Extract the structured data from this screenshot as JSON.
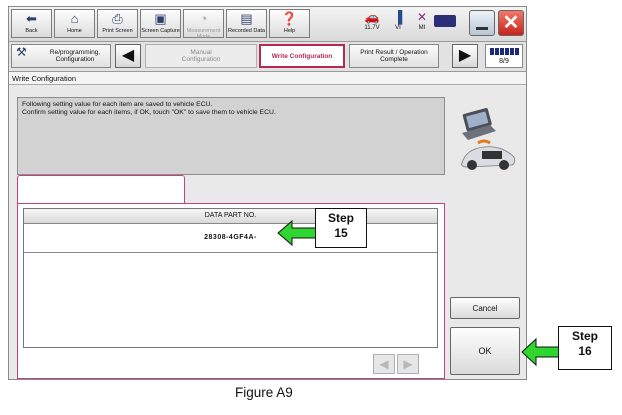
{
  "toolbar": {
    "buttons": [
      {
        "label": "Back",
        "icon": "back-arrow-icon"
      },
      {
        "label": "Home",
        "icon": "home-icon"
      },
      {
        "label": "Print Screen",
        "icon": "printer-icon"
      },
      {
        "label": "Screen Capture",
        "icon": "camera-icon"
      },
      {
        "label": "Measurement Mode",
        "icon": "meter-icon"
      },
      {
        "label": "Recorded Data",
        "icon": "recorded-data-icon"
      },
      {
        "label": "Help",
        "icon": "help-icon"
      }
    ],
    "voltage": "11.7V",
    "vi": "VI",
    "mi": "MI"
  },
  "breadcrumbs": {
    "step1": "Re/programming, Configuration",
    "step2": "Manual Configuration",
    "step3": "Write Configuration",
    "step4": "Print Result / Operation Complete",
    "page": "8/9"
  },
  "screen": {
    "title": "Write Configuration",
    "message_line1": "Following setting value for each item are saved to vehicle ECU.",
    "message_line2": "Confirm setting value for each items, if OK, touch \"OK\" to save them to vehicle ECU.",
    "table_header": "DATA PART NO.",
    "table_value": "28308-4GF4A-"
  },
  "buttons": {
    "cancel": "Cancel",
    "ok": "OK"
  },
  "annotations": {
    "step15_line1": "Step",
    "step15_line2": "15",
    "step16_line1": "Step",
    "step16_line2": "16"
  },
  "caption": "Figure A9",
  "colors": {
    "accent": "#b4285a",
    "arrow": "#2fd62f",
    "close": "#d8342a"
  }
}
